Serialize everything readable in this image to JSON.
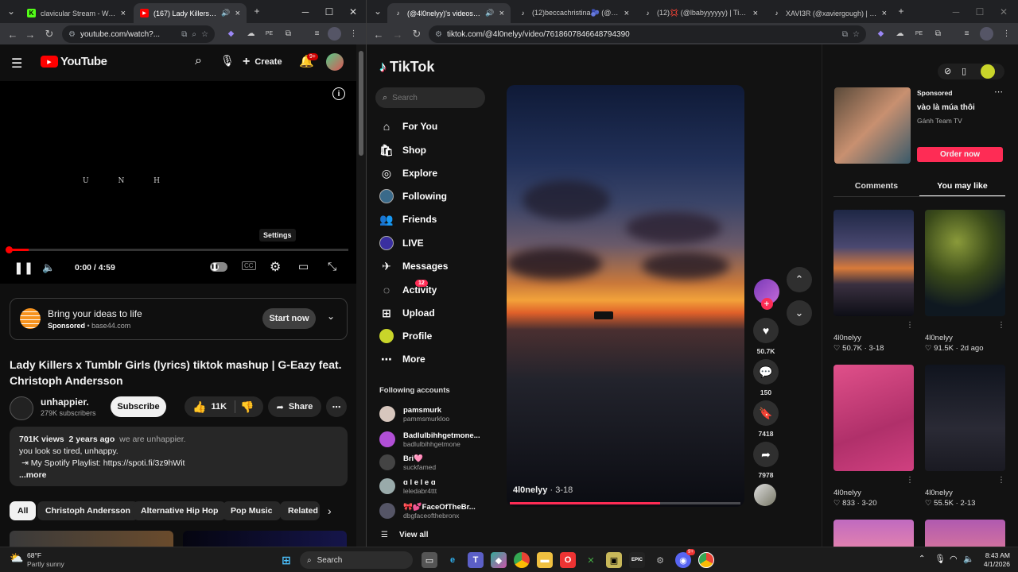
{
  "left_browser": {
    "tabs": [
      {
        "title": "clavicular Stream - Watch Li",
        "fav": "K"
      },
      {
        "title": "(167) Lady Killers x Tumbl",
        "fav": "▶"
      }
    ],
    "url": "youtube.com/watch?...",
    "youtube": {
      "logo": "YouTube",
      "create": "Create",
      "notif_badge": "9+",
      "video_overlay_text": "U N H",
      "settings_tooltip": "Settings",
      "time": "0:00 / 4:59",
      "progress_fraction": 0.06,
      "ad": {
        "title": "Bring your ideas to life",
        "sponsored": "Sponsored",
        "domain": "base44.com",
        "button": "Start now"
      },
      "video_title": "Lady Killers x Tumblr Girls (lyrics) tiktok mashup | G-Eazy feat. Christoph Andersson",
      "channel": {
        "name": "unhappier.",
        "subs": "279K subscribers",
        "subscribe": "Subscribe"
      },
      "likes": "11K",
      "share": "Share",
      "description": {
        "views": "701K views",
        "age": "2 years ago",
        "tagline": "we are unhappier.",
        "line1": "you look so tired, unhappy.",
        "line2": "⇥ My Spotify Playlist:  https://spoti.fi/3z9hWit",
        "more": "...more"
      },
      "chips": [
        "All",
        "Christoph Andersson",
        "Alternative Hip Hop",
        "Pop Music",
        "Related"
      ]
    }
  },
  "right_browser": {
    "tabs": [
      {
        "title": "(@4l0nelyy)'s videos with c"
      },
      {
        "title": "(12)beccachristina🫐 (@beccac"
      },
      {
        "title": "(12)💢 (@lbabyyyyyy) | TikTok"
      },
      {
        "title": "XAVI3R (@xaviergough) | TikTok"
      }
    ],
    "url": "tiktok.com/@4l0nelyy/video/7618607846648794390",
    "tiktok": {
      "logo": "TikTok",
      "search_placeholder": "Search",
      "nav": [
        {
          "label": "For You",
          "icon": "home-icon"
        },
        {
          "label": "Shop",
          "icon": "shop-icon"
        },
        {
          "label": "Explore",
          "icon": "compass-icon"
        },
        {
          "label": "Following",
          "icon": "following-icon"
        },
        {
          "label": "Friends",
          "icon": "friends-icon"
        },
        {
          "label": "LIVE",
          "icon": "live-icon"
        },
        {
          "label": "Messages",
          "icon": "messages-icon"
        },
        {
          "label": "Activity",
          "icon": "activity-icon"
        },
        {
          "label": "Upload",
          "icon": "upload-icon"
        },
        {
          "label": "Profile",
          "icon": "profile-icon"
        },
        {
          "label": "More",
          "icon": "more-icon"
        }
      ],
      "activity_badge": "12",
      "following_header": "Following accounts",
      "accounts": [
        {
          "name": "pamsmurk",
          "handle": "pammsmurkloo",
          "color": "#d7c6bd"
        },
        {
          "name": "Badlulbihhgetmone...",
          "handle": "badlulbihhgetmone",
          "color": "#b14fd6"
        },
        {
          "name": "Bri🩷",
          "handle": "suckfamed",
          "color": "#444"
        },
        {
          "name": "ɑ l e l e ɑ",
          "handle": "leledabr4ttt",
          "color": "#9aa"
        },
        {
          "name": "🎀💕FaceOfTheBr...",
          "handle": "dbgfaceofthebronx",
          "color": "#556"
        }
      ],
      "view_all": "View all",
      "video": {
        "author": "4l0nelyy",
        "date": "3-18"
      },
      "actions": {
        "likes": "50.7K",
        "comments": "150",
        "saves": "7418",
        "shares": "7978"
      },
      "sponsored": {
        "label": "Sponsored",
        "title": "vào là múa thôi",
        "brand": "Gánh Team TV",
        "button": "Order now"
      },
      "panel_tabs": [
        "Comments",
        "You may like"
      ],
      "suggestions": [
        {
          "author": "4l0nelyy",
          "likes": "50.7K",
          "date": "3-18"
        },
        {
          "author": "4l0nelyy",
          "likes": "91.5K",
          "date": "2d ago"
        },
        {
          "author": "4l0nelyy",
          "likes": "833",
          "date": "3-20"
        },
        {
          "author": "4l0nelyy",
          "likes": "55.5K",
          "date": "2-13"
        }
      ]
    }
  },
  "taskbar": {
    "weather_temp": "68°F",
    "weather_desc": "Partly sunny",
    "search": "Search",
    "time": "8:43 AM",
    "date": "4/1/2026",
    "discord_badge": "9+"
  },
  "colors": {
    "yt_red": "#ff0000",
    "tiktok_red": "#fe2c55",
    "progress_red": "#ff0000"
  }
}
